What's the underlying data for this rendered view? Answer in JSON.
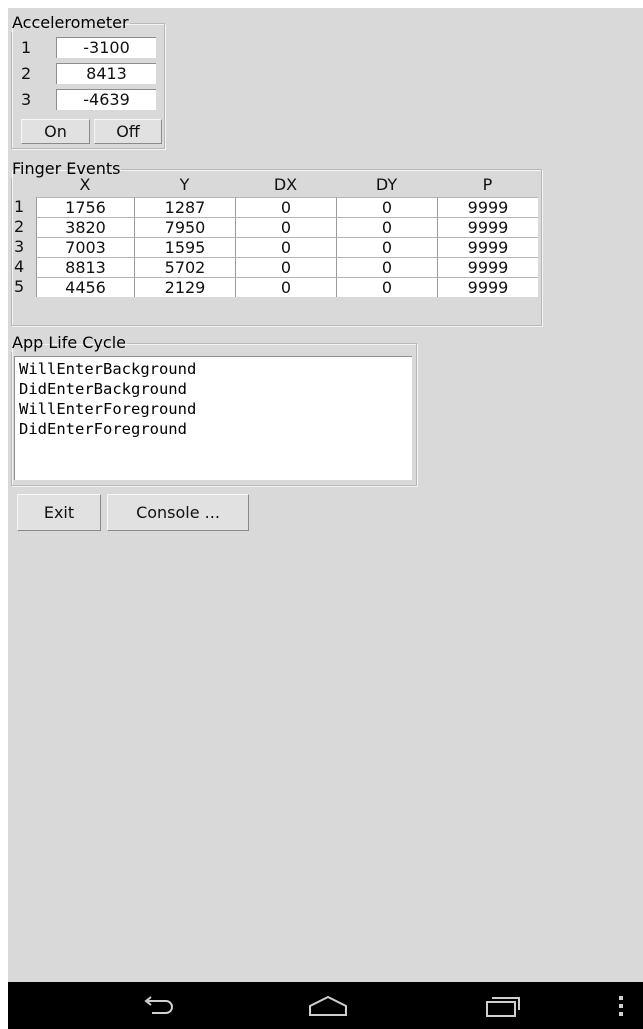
{
  "accelerometer": {
    "title": "Accelerometer",
    "rows": [
      {
        "index": "1",
        "value": "-3100"
      },
      {
        "index": "2",
        "value": "8413"
      },
      {
        "index": "3",
        "value": "-4639"
      }
    ],
    "on_label": "On",
    "off_label": "Off"
  },
  "finger_events": {
    "title": "Finger Events",
    "columns": [
      "X",
      "Y",
      "DX",
      "DY",
      "P"
    ],
    "rows": [
      {
        "index": "1",
        "cells": [
          "1756",
          "1287",
          "0",
          "0",
          "9999"
        ]
      },
      {
        "index": "2",
        "cells": [
          "3820",
          "7950",
          "0",
          "0",
          "9999"
        ]
      },
      {
        "index": "3",
        "cells": [
          "7003",
          "1595",
          "0",
          "0",
          "9999"
        ]
      },
      {
        "index": "4",
        "cells": [
          "8813",
          "5702",
          "0",
          "0",
          "9999"
        ]
      },
      {
        "index": "5",
        "cells": [
          "4456",
          "2129",
          "0",
          "0",
          "9999"
        ]
      }
    ]
  },
  "life_cycle": {
    "title": "App Life Cycle",
    "lines": [
      "WillEnterBackground",
      "DidEnterBackground",
      "WillEnterForeground",
      "DidEnterForeground"
    ]
  },
  "buttons": {
    "exit_label": "Exit",
    "console_label": "Console ..."
  },
  "navbar": {
    "icons": [
      "back-icon",
      "home-icon",
      "recent-apps-icon",
      "menu-icon"
    ],
    "background": "#000000",
    "icon_color": "#cfcfcf"
  }
}
